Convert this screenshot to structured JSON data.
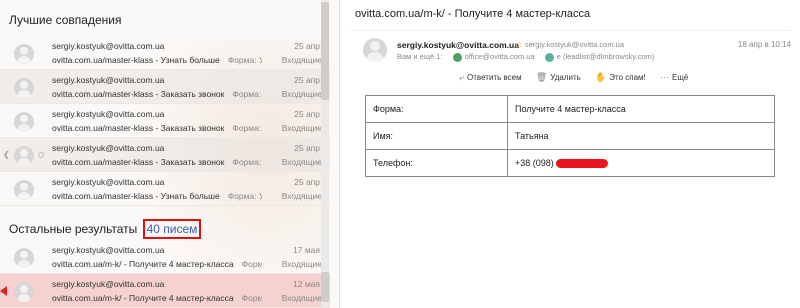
{
  "left": {
    "best_matches_title": "Лучшие совпадения",
    "other_results_title": "Остальные результаты",
    "other_results_count": "40 писем",
    "best_messages": [
      {
        "from": "sergiy.kostyuk@ovitta.com.ua",
        "subject": "ovitta.com.ua/master-klass - Узнать больше",
        "preview": "Форма: Уз...",
        "date": "25 апр",
        "folder": "Входящие"
      },
      {
        "from": "sergiy.kostyuk@ovitta.com.ua",
        "subject": "ovitta.com.ua/master-klass - Заказать звонок",
        "preview": "Форма: З...",
        "date": "25 апр",
        "folder": "Входящие"
      },
      {
        "from": "sergiy.kostyuk@ovitta.com.ua",
        "subject": "ovitta.com.ua/master-klass - Заказать звонок",
        "preview": "Форма: З...",
        "date": "25 апр",
        "folder": "Входящие"
      },
      {
        "from": "sergiy.kostyuk@ovitta.com.ua",
        "subject": "ovitta.com.ua/master-klass - Заказать звонок",
        "preview": "Форма: З...",
        "date": "25 апр",
        "folder": "Входящие"
      },
      {
        "from": "sergiy.kostyuk@ovitta.com.ua",
        "subject": "ovitta.com.ua/master-klass - Узнать больше",
        "preview": "Форма: Уз...",
        "date": "25 апр",
        "folder": "Входящие"
      }
    ],
    "other_messages": [
      {
        "from": "sergiy.kostyuk@ovitta.com.ua",
        "subject": "ovitta.com.ua/m-k/ - Получите 4 мастер-класса",
        "preview": "Форма: П...",
        "date": "17 мая",
        "folder": "Входящие"
      },
      {
        "from": "sergiy.kostyuk@ovitta.com.ua",
        "subject": "ovitta.com.ua/m-k/ - Получите 4 мастер-класса",
        "preview": "Форма: П...",
        "date": "12 мая",
        "folder": "Входящие"
      }
    ]
  },
  "message": {
    "title": "ovitta.com.ua/m-k/ - Получите 4 мастер-класса",
    "sender": "sergiy.kostyuk@ovitta.com.ua",
    "sender_alt": "sergiy.kostyuk@ovitta.com.ua",
    "date": "18 апр в 10:14",
    "to_prefix": "Вам и ещё 1:",
    "recipient_1": "office@ovitta.com.ua",
    "recipient_2": "leadlist@dlmbrowsky.com",
    "recipient_2_initial": "e",
    "actions": {
      "reply_all": "Ответить всем",
      "delete": "Удалить",
      "spam": "Это спам!",
      "more": "Ещё"
    },
    "form_table": [
      {
        "key": "Форма:",
        "value": "Получите 4 мастер-класса"
      },
      {
        "key": "Имя:",
        "value": "Татьяна"
      },
      {
        "key": "Телефон:",
        "value": "+38 (098)"
      }
    ]
  },
  "colors": {
    "highlight_red": "#d11111",
    "selected_row": "#f5d2cf",
    "scribble": "#e8141f"
  }
}
